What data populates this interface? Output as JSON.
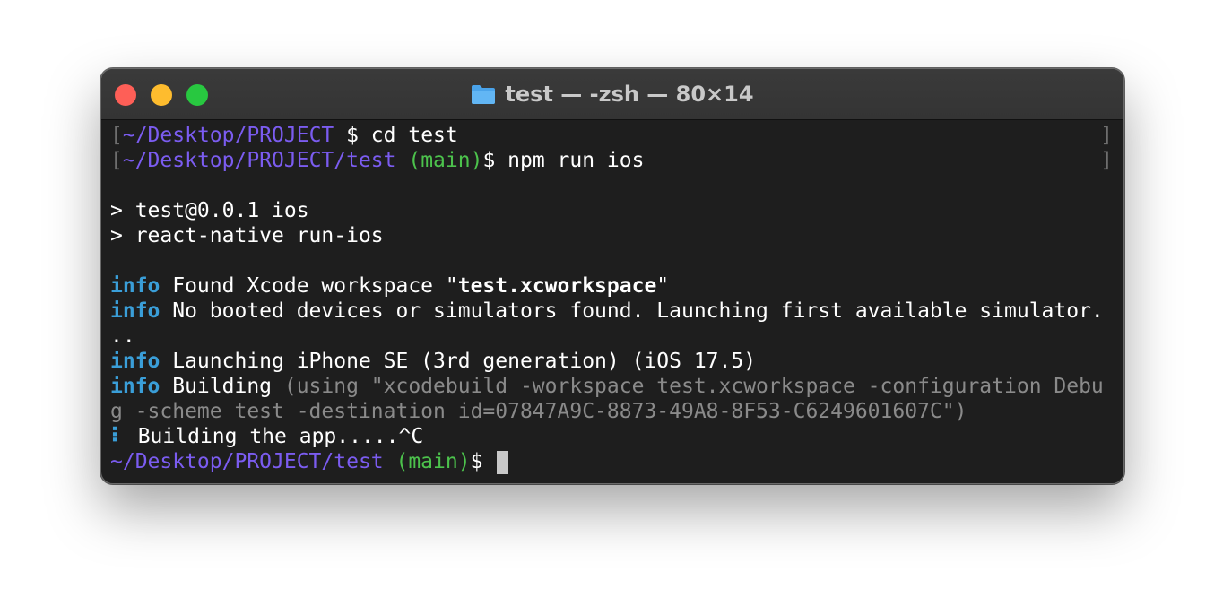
{
  "window": {
    "title": "test — -zsh — 80×14"
  },
  "terminal": {
    "line1": {
      "bracket": "[",
      "path": "~/Desktop/PROJECT",
      "cmd": " $ cd test",
      "rbracket": "]"
    },
    "line2": {
      "bracket": "[",
      "path": "~/Desktop/PROJECT/test",
      "branch": " (main)",
      "cmd": "$ npm run ios",
      "rbracket": "]"
    },
    "line3": "",
    "line4": "> test@0.0.1 ios",
    "line5": "> react-native run-ios",
    "line6": "",
    "line7": {
      "tag": "info",
      "pre": " Found Xcode workspace \"",
      "bold": "test.xcworkspace",
      "post": "\""
    },
    "line8": {
      "tag": "info",
      "text": " No booted devices or simulators found. Launching first available simulator."
    },
    "line9": "..",
    "line10": {
      "tag": "info",
      "text": " Launching iPhone SE (3rd generation) (iOS 17.5)"
    },
    "line11": {
      "tag": "info",
      "text": " Building",
      "dim": " (using \"xcodebuild -workspace test.xcworkspace -configuration Debu"
    },
    "line12": {
      "dim": "g -scheme test -destination id=07847A9C-8873-49A8-8F53-C6249601607C\")"
    },
    "line13": {
      "spinner": "⠇",
      "text": " Building the app.....^C"
    },
    "line14": {
      "path": "~/Desktop/PROJECT/test",
      "branch": " (main)",
      "cmd": "$ "
    }
  },
  "colors": {
    "path": "#7b5cf0",
    "branch": "#4cc24c",
    "info": "#3a9ed8",
    "dim": "#8a8a8a",
    "background": "#1e1e1e"
  },
  "icons": {
    "title": "folder-icon",
    "buttons": [
      "close-button",
      "minimize-button",
      "zoom-button"
    ]
  }
}
